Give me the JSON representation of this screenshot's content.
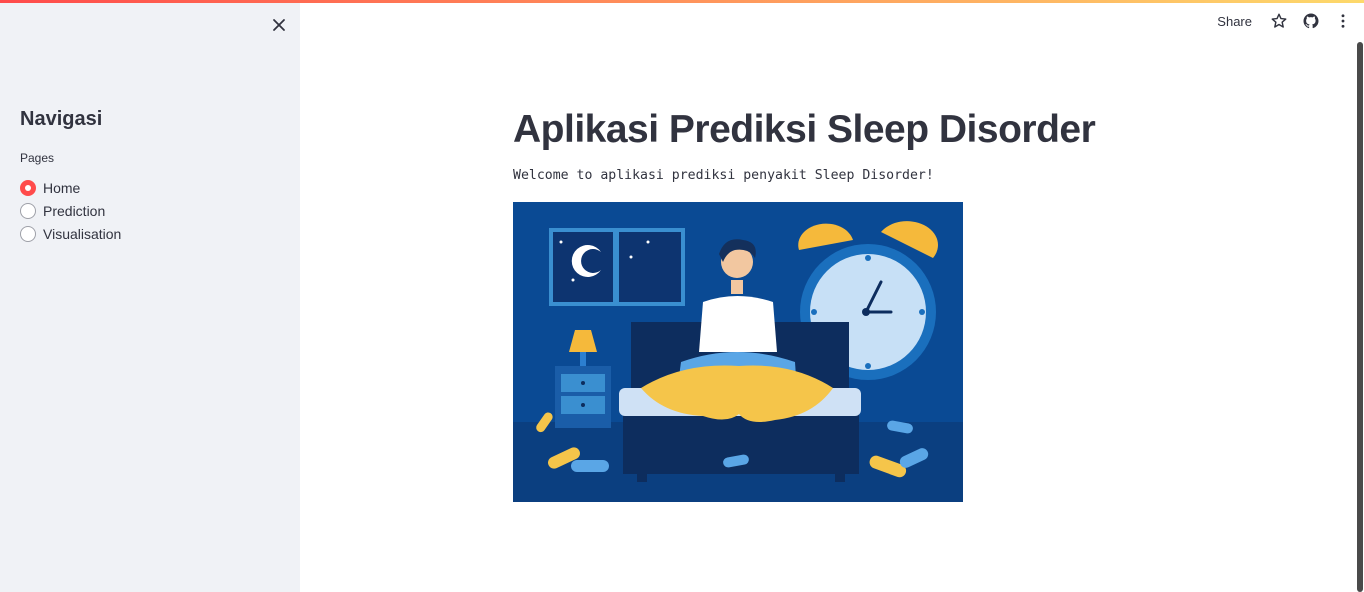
{
  "sidebar": {
    "title": "Navigasi",
    "pages_label": "Pages",
    "options": [
      {
        "label": "Home",
        "selected": true
      },
      {
        "label": "Prediction",
        "selected": false
      },
      {
        "label": "Visualisation",
        "selected": false
      }
    ],
    "close_icon": "close-icon"
  },
  "toolbar": {
    "share_label": "Share",
    "icons": [
      "star-icon",
      "github-icon",
      "more-vert-icon"
    ]
  },
  "main": {
    "title": "Aplikasi Prediksi Sleep Disorder",
    "welcome": "Welcome to aplikasi prediksi penyakit Sleep Disorder!"
  },
  "colors": {
    "accent": "#ff4b4b",
    "sidebar_bg": "#f0f2f6",
    "text": "#31333f",
    "illustration_bg": "#0a4a94"
  }
}
